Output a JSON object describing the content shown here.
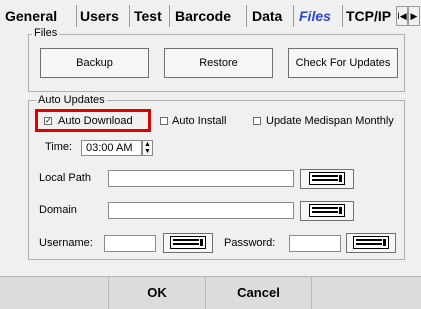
{
  "tabs": [
    {
      "label": "General"
    },
    {
      "label": "Users"
    },
    {
      "label": "Test"
    },
    {
      "label": "Barcode"
    },
    {
      "label": "Data"
    },
    {
      "label": "Files"
    },
    {
      "label": "TCP/IP"
    }
  ],
  "tab_nav": {
    "prev": "I◀",
    "next": "▶"
  },
  "files_group": {
    "label": "Files",
    "backup": "Backup",
    "restore": "Restore",
    "check_updates": "Check For Updates"
  },
  "auto_updates": {
    "label": "Auto Updates",
    "auto_download": {
      "label": "Auto Download",
      "checked": true
    },
    "auto_install": {
      "label": "Auto Install",
      "checked": false
    },
    "update_medispan": {
      "label": "Update Medispan Monthly",
      "checked": false
    },
    "time_label": "Time:",
    "time_value": "03:00 AM",
    "local_path_label": "Local Path",
    "local_path_value": "",
    "domain_label": "Domain",
    "domain_value": "",
    "username_label": "Username:",
    "username_value": "",
    "password_label": "Password:",
    "password_value": ""
  },
  "footer": {
    "ok": "OK",
    "cancel": "Cancel"
  },
  "colors": {
    "active_tab": "#2b46d6",
    "highlight": "#e00000"
  }
}
